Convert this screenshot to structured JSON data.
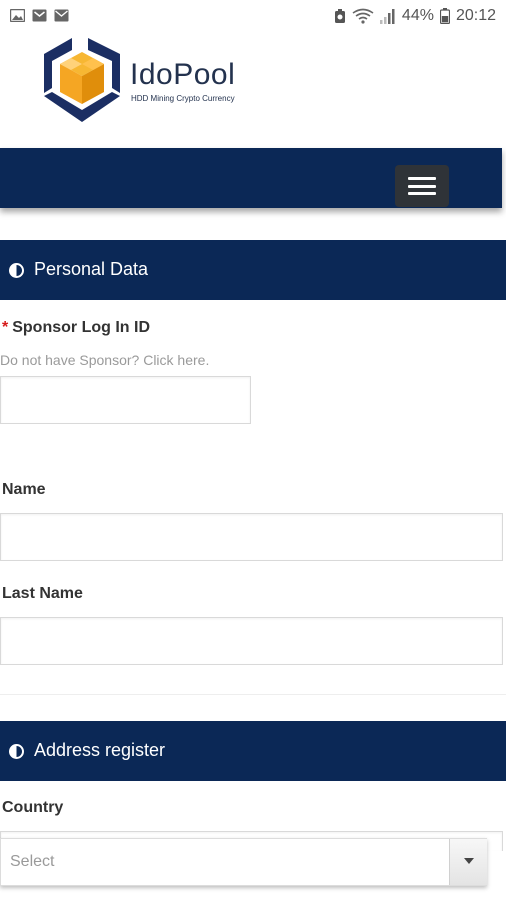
{
  "status_bar": {
    "battery": "44%",
    "time": "20:12"
  },
  "brand": {
    "name": "IdoPool",
    "tagline": "HDD Mining Crypto Currency"
  },
  "sections": {
    "personal": {
      "title": "Personal Data",
      "icon": "half-circle-icon"
    },
    "address": {
      "title": "Address register",
      "icon": "half-circle-icon"
    }
  },
  "form": {
    "sponsor": {
      "required_mark": "*",
      "label": "Sponsor Log In ID",
      "hint": "Do not have Sponsor? Click here.",
      "value": ""
    },
    "name": {
      "label": "Name",
      "value": ""
    },
    "last_name": {
      "label": "Last Name",
      "value": ""
    },
    "country": {
      "label": "Country",
      "selected": "Select"
    }
  },
  "colors": {
    "navy": "#0b2856",
    "menu_button": "#2f3338",
    "required": "#d61b1b",
    "logo_yellow": "#f5a623",
    "logo_navy": "#1b2e63"
  }
}
